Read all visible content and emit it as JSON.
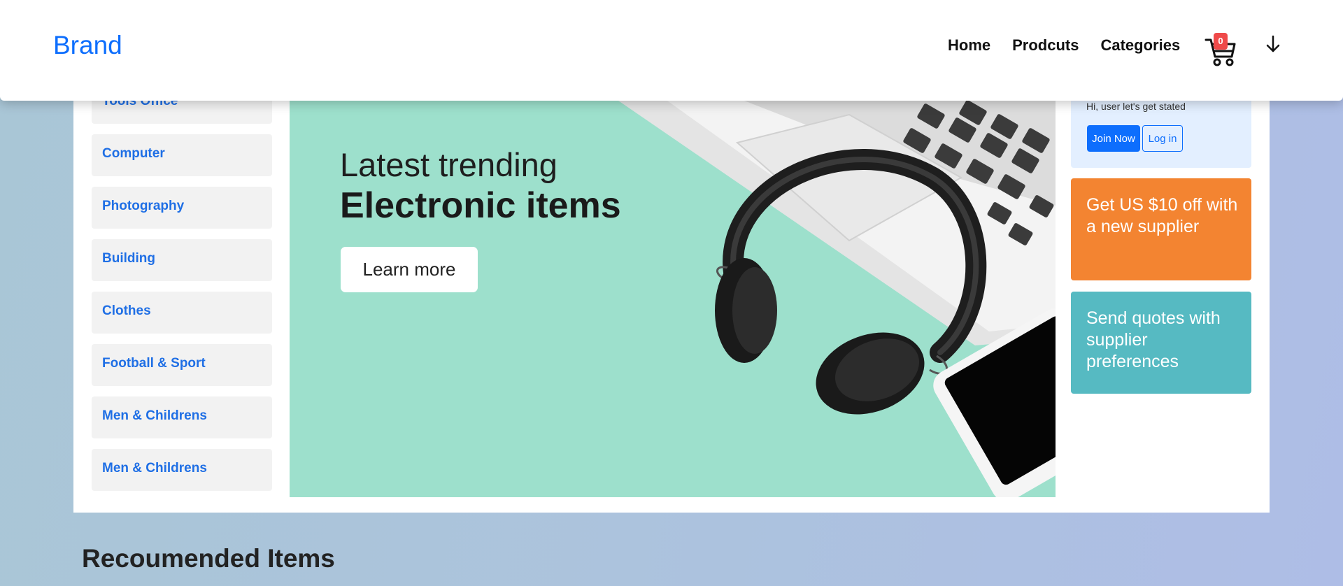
{
  "navbar": {
    "brand": "Brand",
    "links": [
      "Home",
      "Prodcuts",
      "Categories"
    ],
    "cart_count": "0"
  },
  "sidebar": {
    "items": [
      {
        "label": "Tools Office"
      },
      {
        "label": "Computer"
      },
      {
        "label": "Photography"
      },
      {
        "label": "Building"
      },
      {
        "label": "Clothes"
      },
      {
        "label": "Football & Sport"
      },
      {
        "label": "Men & Childrens"
      },
      {
        "label": "Men & Childrens"
      }
    ]
  },
  "banner": {
    "line1": "Latest trending",
    "line2": "Electronic items",
    "cta": "Learn more"
  },
  "user_box": {
    "greeting": "Hi, user let's get stated",
    "join_label": "Join Now",
    "login_label": "Log in"
  },
  "promos": {
    "offer": "Get US $10 off with a new supplier",
    "quotes": "Send quotes with supplier preferences"
  },
  "recommended": {
    "title": "Recoumended Items"
  },
  "colors": {
    "brand_blue": "#0d6efd",
    "promo_orange": "#f38431",
    "promo_teal": "#56bac2",
    "banner_mint": "#9de0cc",
    "badge_red": "#ef4a4a"
  }
}
